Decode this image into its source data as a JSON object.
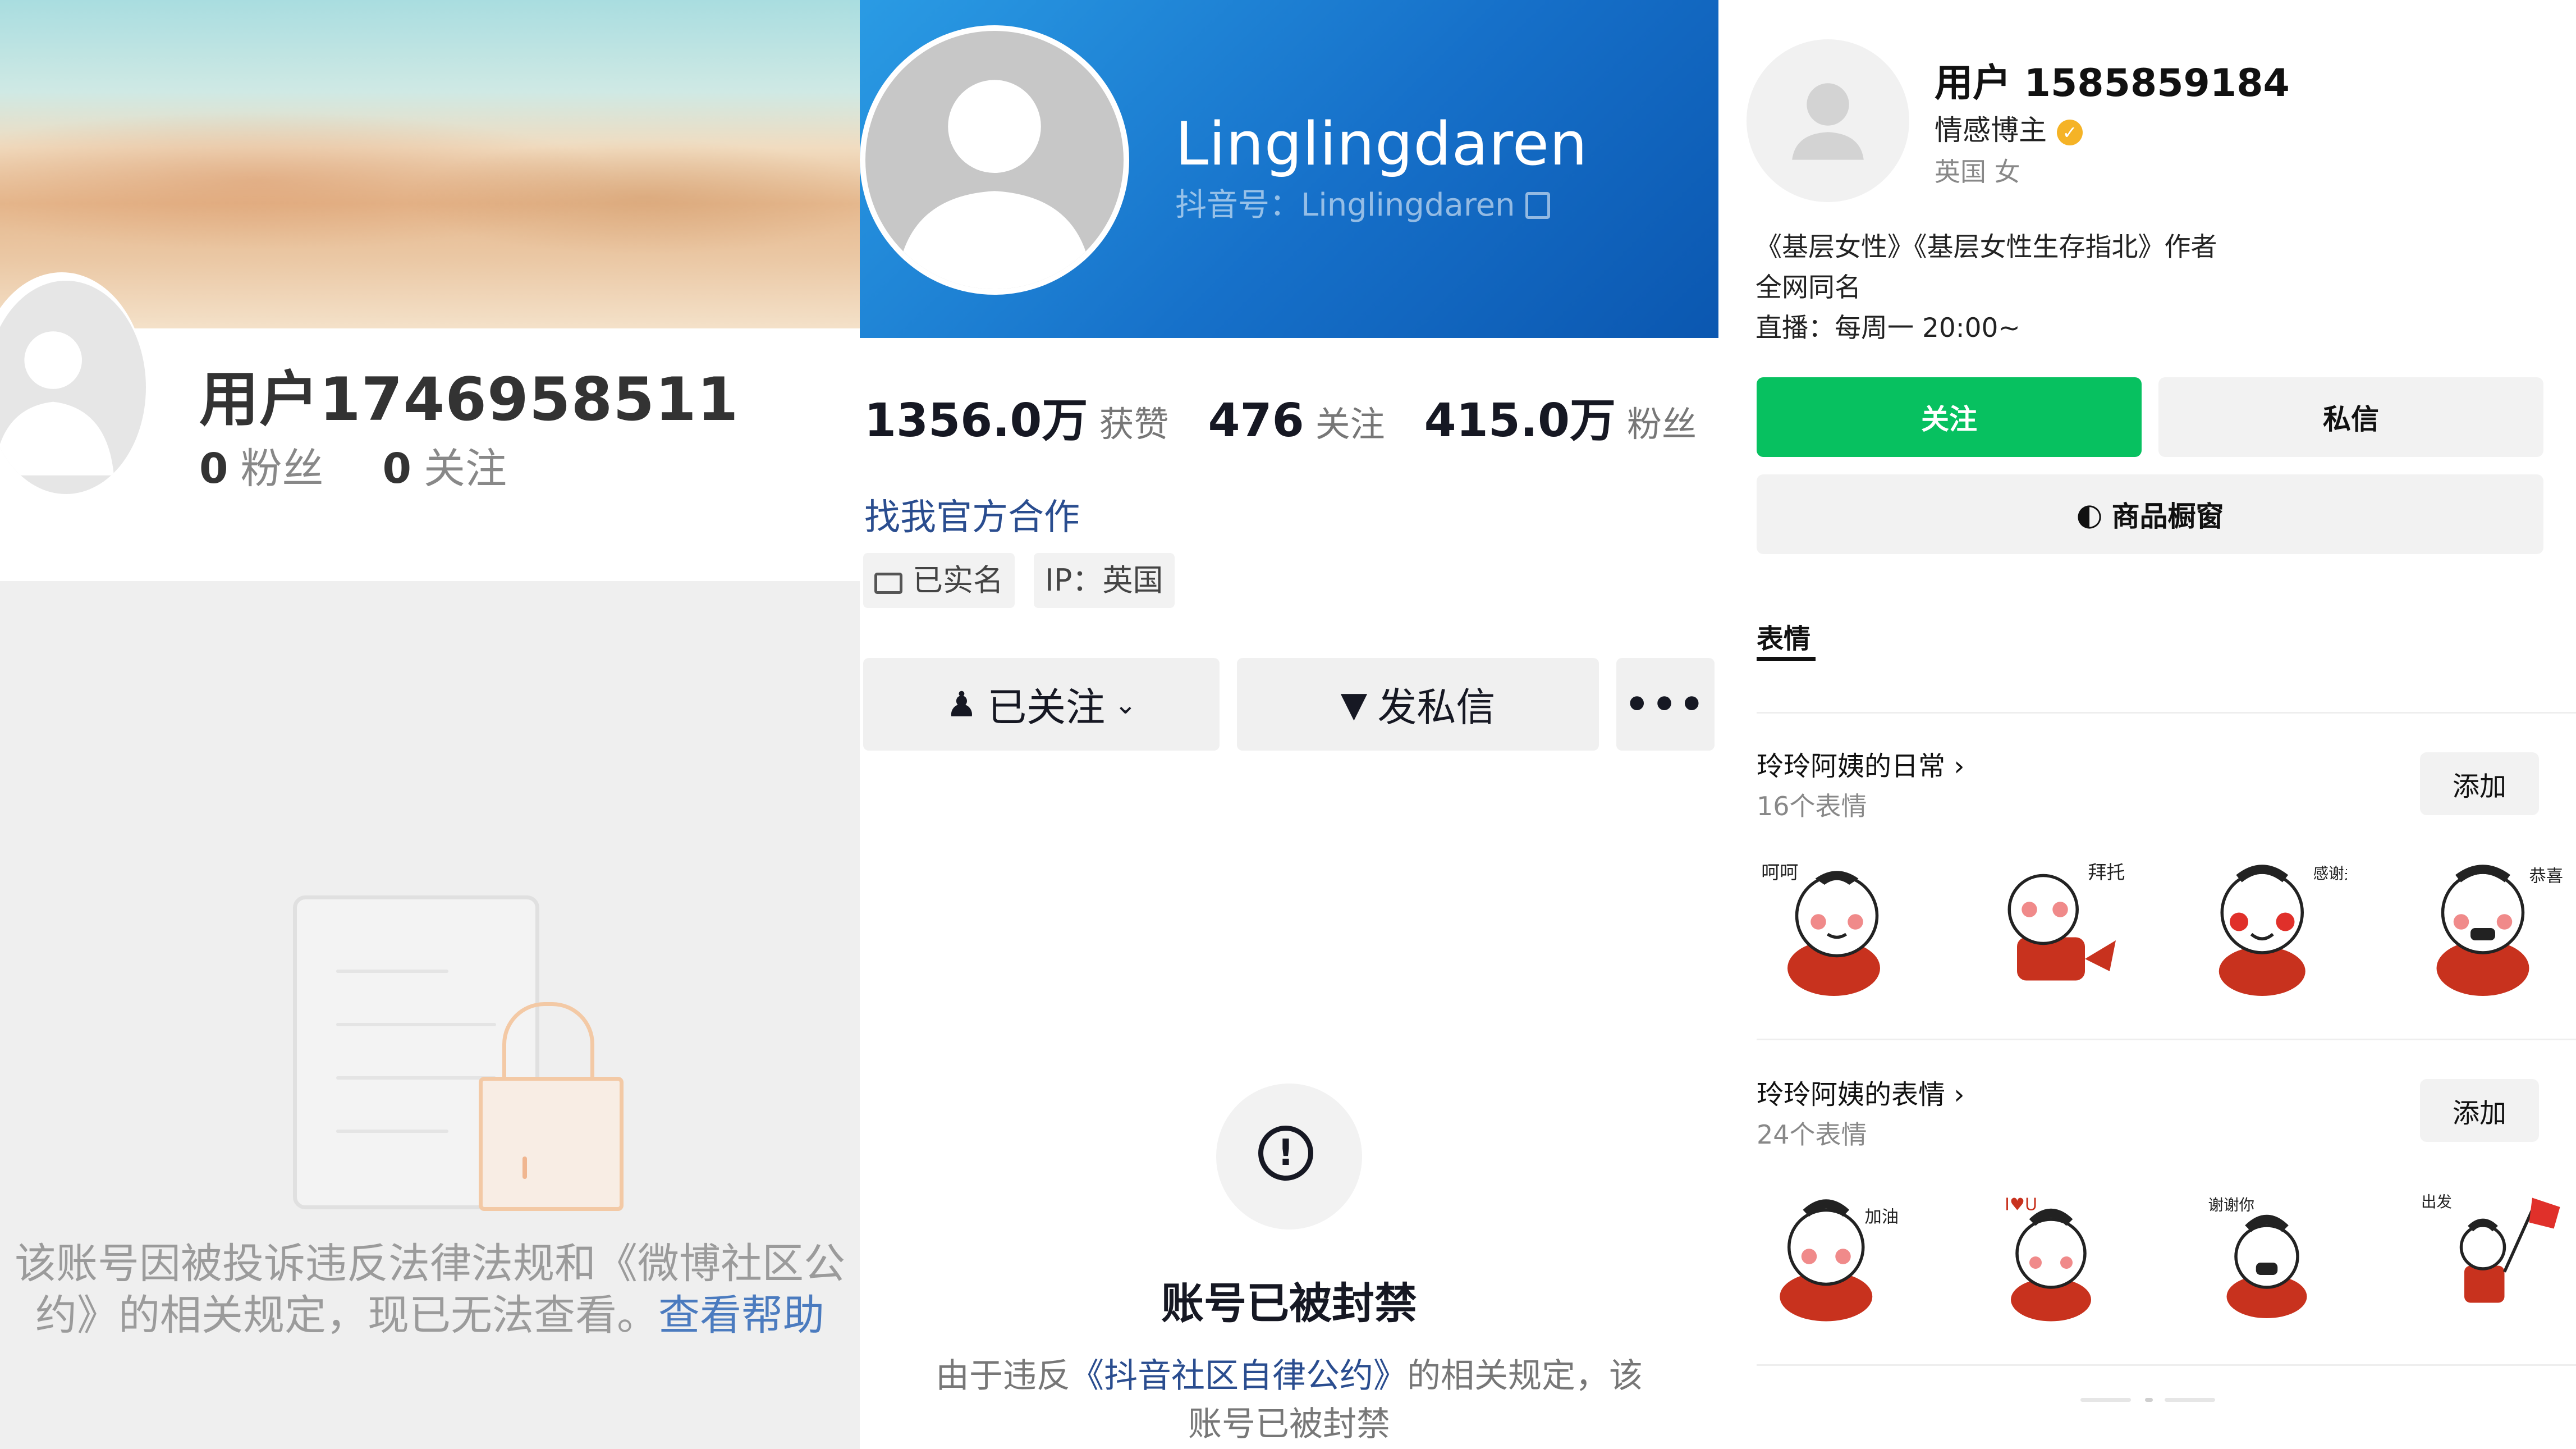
{
  "weibo": {
    "username": "用户1746958511",
    "stats": [
      {
        "num": "0",
        "label": "粉丝"
      },
      {
        "num": "0",
        "label": "关注"
      }
    ],
    "message": [
      "该账号因被投诉违反法律法规和《微博社区公",
      "约》的相关规定，现已无法查看。"
    ],
    "help_link": "查看帮助"
  },
  "douyin": {
    "name": "Linglingdaren",
    "id_text": "抖音号：Linglingdaren",
    "stats": [
      {
        "num": "1356.0万",
        "label": "获赞"
      },
      {
        "num": "476",
        "label": "关注"
      },
      {
        "num": "415.0万",
        "label": "粉丝"
      }
    ],
    "coop_link": "找我官方合作",
    "tags": [
      "已实名",
      "IP：英国"
    ],
    "follow_button": "已关注",
    "dm_button": "发私信",
    "more_button": "•••",
    "banned_title": "账号已被封禁",
    "reason_prefix": "由于违反",
    "reason_link": "《抖音社区自律公约》",
    "reason_suffix": "的相关规定，该",
    "reason_line2": "账号已被封禁"
  },
  "wechat": {
    "name": "用户 1585859184",
    "role": "情感博主",
    "location": "英国 女",
    "bio": [
      "《基层女性》《基层女性生存指北》作者",
      "全网同名",
      "直播：每周一 20:00~"
    ],
    "follow_button": "关注",
    "dm_button": "私信",
    "shop_button": "商品橱窗",
    "tab": "表情",
    "packs": [
      {
        "title": "玲玲阿姨的日常",
        "count": "16个表情",
        "add": "添加",
        "stickers": [
          {
            "text": "呵呵"
          },
          {
            "text": "拜托"
          },
          {
            "text": "感谢关照"
          },
          {
            "text": "恭喜"
          }
        ]
      },
      {
        "title": "玲玲阿姨的表情",
        "count": "24个表情",
        "add": "添加",
        "stickers": [
          {
            "text": "加油"
          },
          {
            "text": "I♥U"
          },
          {
            "text": "谢谢你"
          },
          {
            "text": "出发"
          }
        ]
      }
    ],
    "colors": {
      "accent": "#07c160",
      "verify": "#f5b326",
      "sticker_red": "#c8321e"
    }
  }
}
